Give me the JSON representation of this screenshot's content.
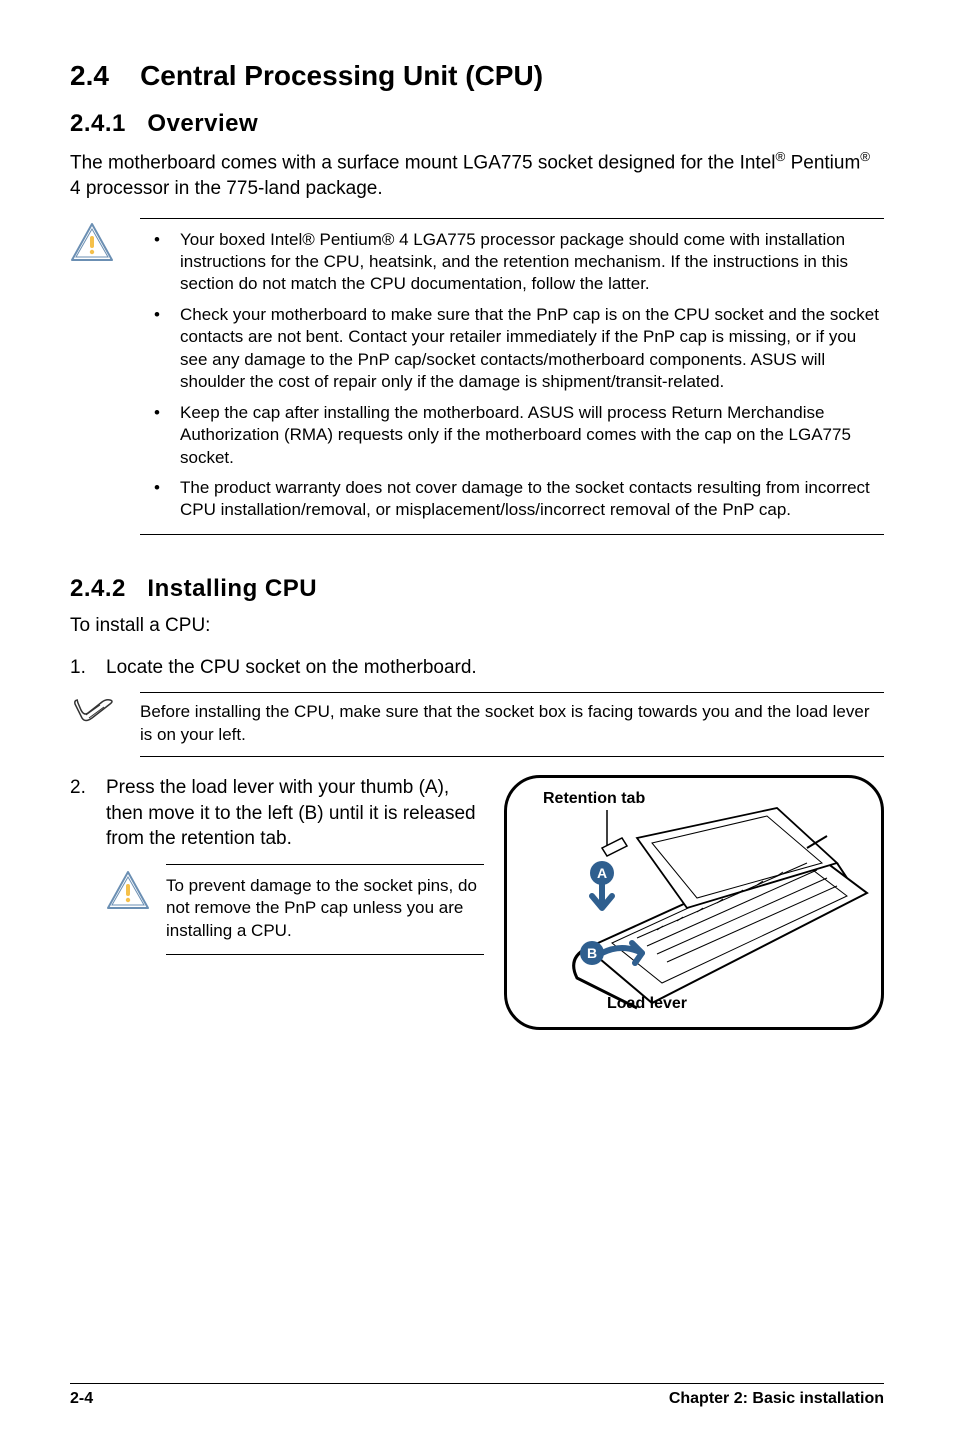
{
  "section": {
    "number": "2.4",
    "title": "Central Processing Unit (CPU)"
  },
  "sub1": {
    "number": "2.4.1",
    "title": "Overview",
    "intro_pre": "The motherboard comes with a surface mount LGA775 socket designed for the Intel",
    "intro_mid": " Pentium",
    "intro_post": " 4 processor in the 775-land package."
  },
  "caution1": {
    "items": [
      "Your boxed Intel® Pentium® 4 LGA775 processor package should come with installation instructions for the CPU, heatsink, and the retention mechanism. If the instructions in this section do not match the CPU documentation, follow the latter.",
      "Check your motherboard to make sure that the PnP cap is on the CPU socket and the socket contacts are not bent. Contact your retailer immediately if the PnP cap is missing, or if you see any damage to the PnP cap/socket contacts/motherboard components. ASUS will shoulder the cost of repair only if the damage is shipment/transit-related.",
      "Keep the cap after installing the motherboard. ASUS will process Return Merchandise Authorization (RMA) requests only if the motherboard comes with the cap on the LGA775 socket.",
      "The product warranty does not cover damage to the socket contacts resulting from incorrect CPU installation/removal, or misplacement/loss/incorrect removal of the PnP cap."
    ]
  },
  "sub2": {
    "number": "2.4.2",
    "title": "Installing CPU",
    "intro": "To install a CPU:",
    "step1": {
      "num": "1.",
      "text": "Locate the CPU socket on the motherboard."
    },
    "note": "Before installing the CPU, make sure that the socket box is facing towards you and the load lever is on your left.",
    "step2": {
      "num": "2.",
      "text": "Press the load lever with your thumb (A), then move it to the left (B) until it is released from the retention tab."
    },
    "caution2": "To prevent damage to the socket pins, do not remove the PnP cap unless you are installing a CPU."
  },
  "diagram": {
    "label_top": "Retention tab",
    "label_bottom": "Load lever",
    "marker_a": "A",
    "marker_b": "B"
  },
  "footer": {
    "left": "2-4",
    "right": "Chapter 2: Basic installation"
  }
}
